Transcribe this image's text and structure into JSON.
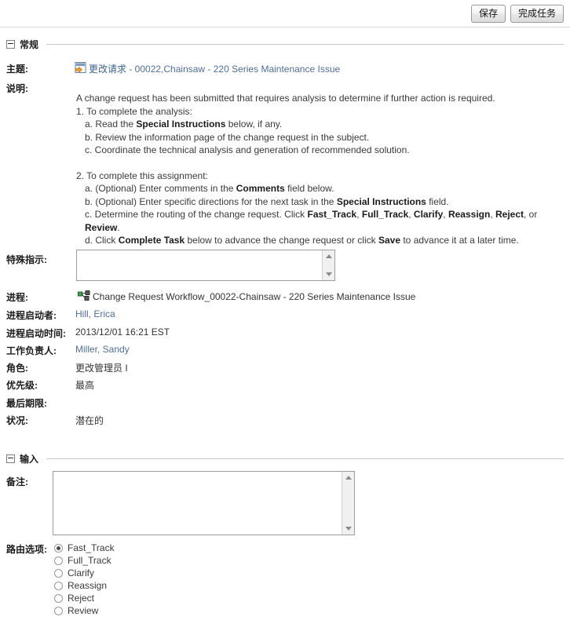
{
  "toolbar": {
    "save_label": "保存",
    "complete_task_label": "完成任务"
  },
  "sections": {
    "general": {
      "title": "常规"
    },
    "input": {
      "title": "输入"
    }
  },
  "general": {
    "subject_label": "主题:",
    "subject_icon": "change-request-icon",
    "subject_link_text": "更改请求",
    "subject_rest_text": " - 00022,Chainsaw  - 220 Series Maintenance Issue",
    "description_label": "说明:",
    "description": {
      "line1": "A change request has been submitted that requires analysis to determine if further action is required.",
      "line2": "1. To complete the analysis:",
      "line3_pre": "a. Read the ",
      "line3_bold": "Special Instructions",
      "line3_post": " below, if any.",
      "line4": "b. Review the information page of the change request in the subject.",
      "line5": "c. Coordinate the technical analysis and generation of recommended solution.",
      "line6": "2. To complete this assignment:",
      "line7_pre": "a. (Optional) Enter comments in the ",
      "line7_bold": "Comments",
      "line7_post": " field below.",
      "line8_pre": "b. (Optional) Enter specific directions for the next task in the ",
      "line8_bold": "Special Instructions",
      "line8_post": " field.",
      "line9_pre": "c. Determine the routing of the change request. Click ",
      "line9_b1": "Fast_Track",
      "line9_s1": ", ",
      "line9_b2": "Full_Track",
      "line9_s2": ", ",
      "line9_b3": "Clarify",
      "line9_s3": ", ",
      "line9_b4": "Reassign",
      "line9_s4": ", ",
      "line9_b5": "Reject",
      "line9_s5": ", or ",
      "line9_b6": "Review",
      "line9_post": ".",
      "line10_pre": "d. Click ",
      "line10_b1": "Complete Task",
      "line10_mid": " below to advance the change request or click ",
      "line10_b2": "Save",
      "line10_post": " to advance it at a later time."
    },
    "special_instructions_label": "特殊指示:",
    "special_instructions_value": "",
    "process_label": "进程:",
    "process_icon": "workflow-icon",
    "process_value": "Change Request Workflow_00022-Chainsaw  - 220 Series Maintenance Issue",
    "process_initiator_label": "进程启动者:",
    "process_initiator_value": "Hill, Erica",
    "process_start_time_label": "进程启动时间:",
    "process_start_time_value": "2013/12/01 16:21 EST",
    "task_owner_label": "工作负责人:",
    "task_owner_value": "Miller, Sandy",
    "role_label": "角色:",
    "role_value": "更改管理员 I",
    "priority_label": "优先级:",
    "priority_value": "最高",
    "due_date_label": "最后期限:",
    "due_date_value": "",
    "status_label": "状况:",
    "status_value": "潜在的"
  },
  "input": {
    "comments_label": "备注:",
    "comments_value": "",
    "routing_label": "路由选项:",
    "routing_options": [
      {
        "label": "Fast_Track",
        "selected": true
      },
      {
        "label": "Full_Track",
        "selected": false
      },
      {
        "label": "Clarify",
        "selected": false
      },
      {
        "label": "Reassign",
        "selected": false
      },
      {
        "label": "Reject",
        "selected": false
      },
      {
        "label": "Review",
        "selected": false
      }
    ]
  },
  "colors": {
    "link": "#4f6f9b",
    "text": "#333333",
    "label": "#1b1b1b",
    "rule": "#c8c8c8"
  }
}
